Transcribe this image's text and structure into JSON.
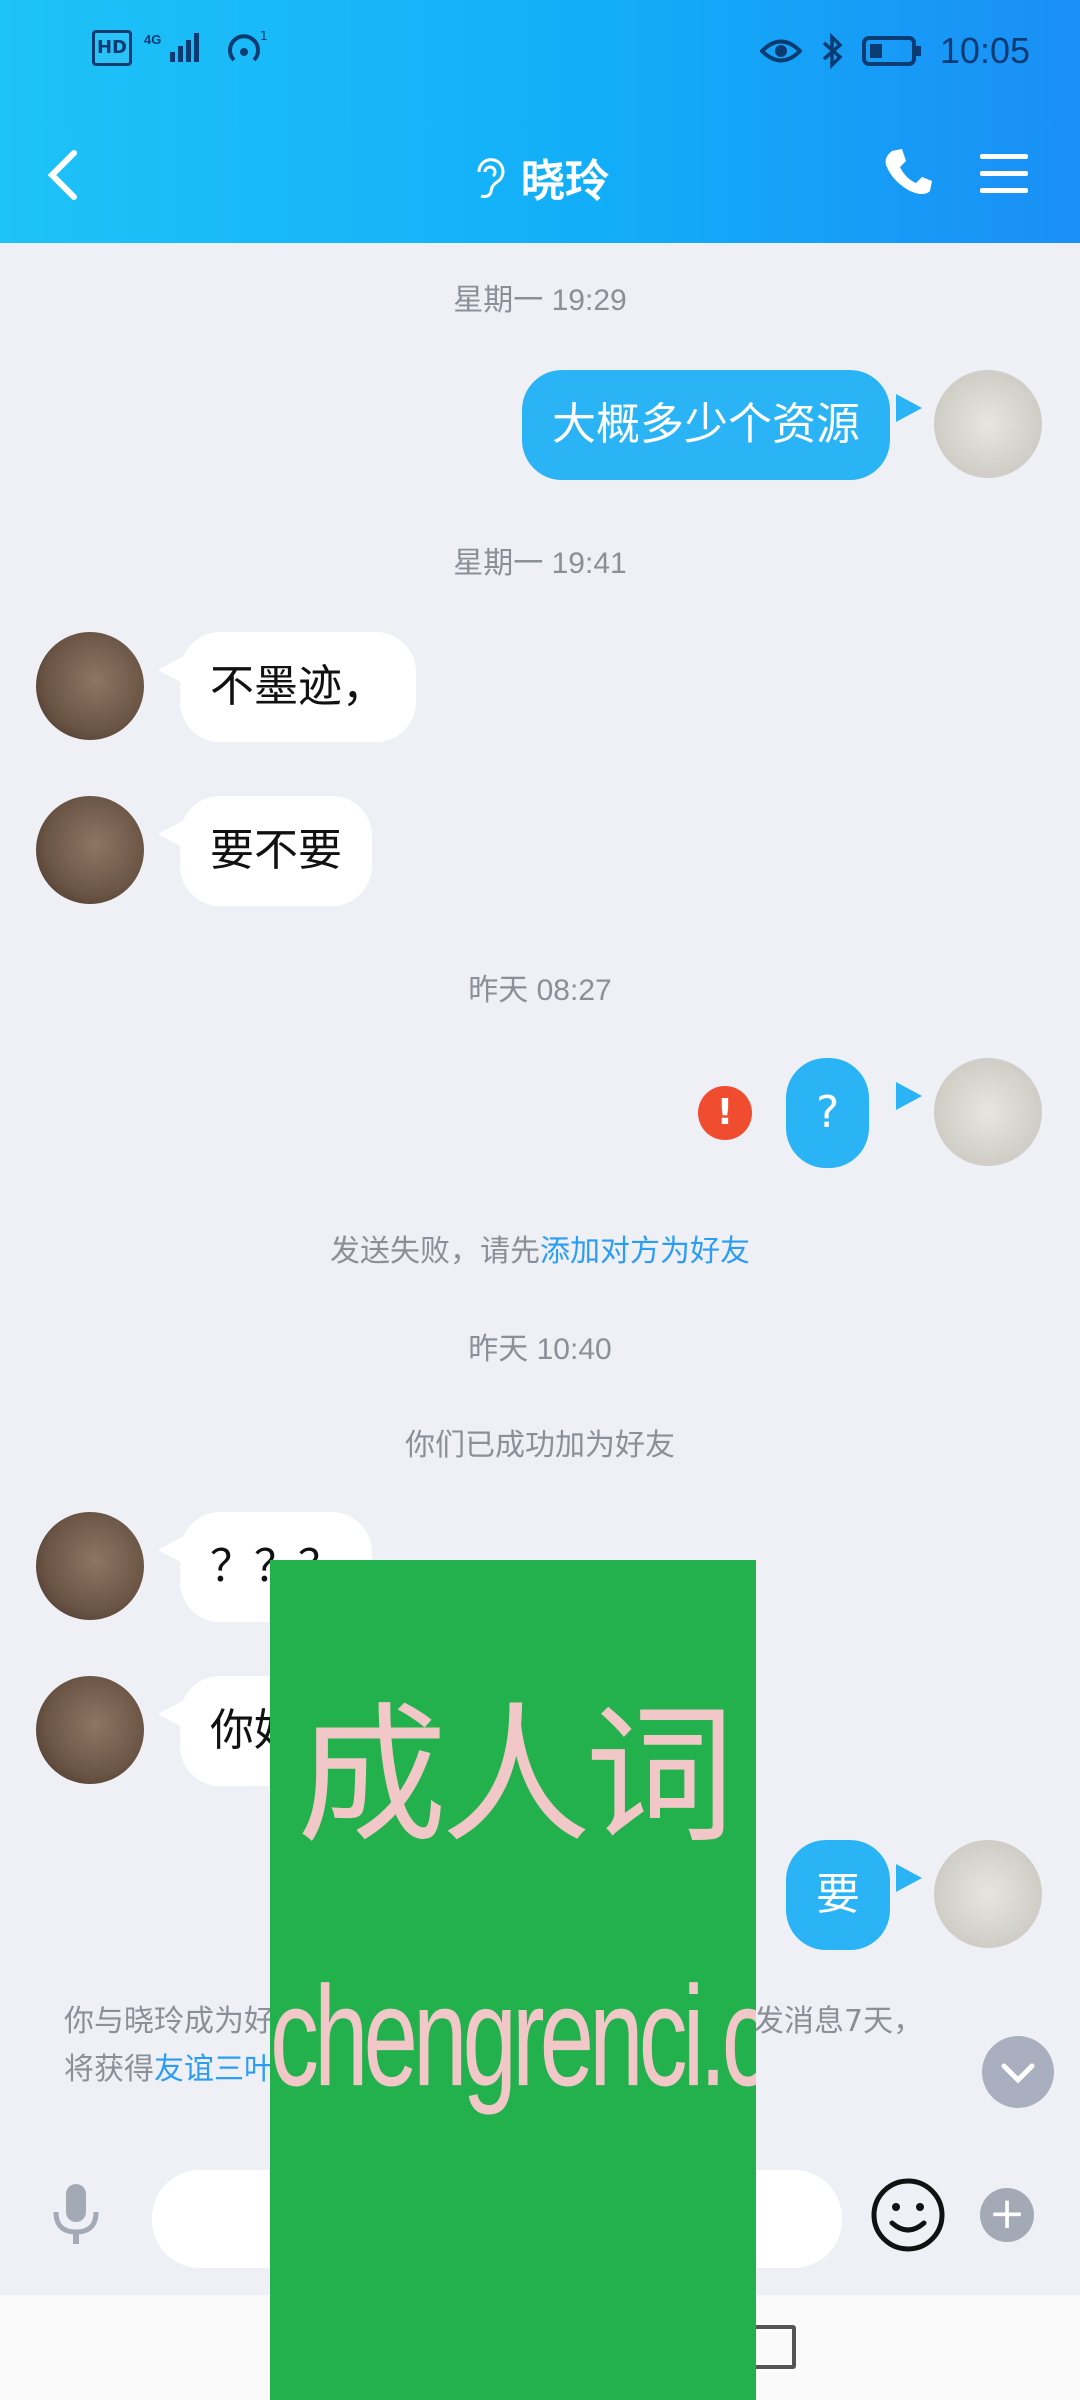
{
  "status_bar": {
    "hd": "HD",
    "network": "4G",
    "time": "10:05"
  },
  "header": {
    "title": "晓玲"
  },
  "messages": {
    "ts1": "星期一 19:29",
    "m1": "大概多少个资源",
    "ts2": "星期一 19:41",
    "m2": "不墨迹，",
    "m3": "要不要",
    "ts3": "昨天 08:27",
    "m4": "?",
    "fail_text": "发送失败，请先",
    "fail_link": "添加对方为好友",
    "ts4": "昨天 10:40",
    "sys_added": "你们已成功加为好友",
    "m5": "？？？",
    "m6": "你好",
    "m7": "要"
  },
  "notice": {
    "line1_start": "你与晓玲成为好",
    "line1_end": "续互发消息7天，",
    "line2_start": "将获得",
    "line2_link": "友谊三叶"
  },
  "input": {
    "placeholder": ""
  },
  "ad": {
    "line1": "成人词",
    "line2": "chengrenci.com"
  },
  "colors": {
    "header_start": "#1ec3f7",
    "header_end": "#1a8ff6",
    "bubble_me": "#2ab4f5",
    "link": "#2b9df5",
    "fail": "#f04c30",
    "ad_bg": "#22b14c"
  }
}
